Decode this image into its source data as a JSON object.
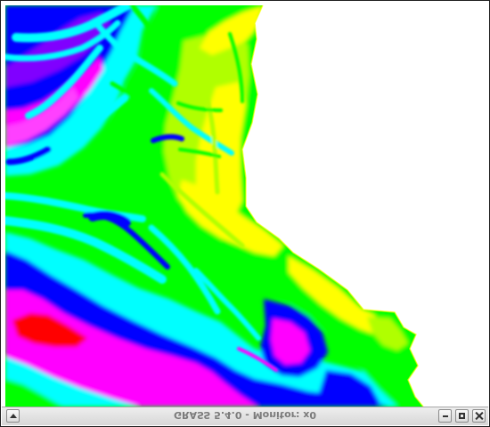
{
  "window": {
    "title": "GRASS 5.4.0 - Monitor: x0"
  },
  "titlebar": {
    "buttons": [
      {
        "name": "window-menu",
        "icon": "triangle-up-icon"
      },
      {
        "name": "minimize",
        "icon": "minimize-icon"
      },
      {
        "name": "maximize",
        "icon": "maximize-icon"
      },
      {
        "name": "close",
        "icon": "close-icon"
      }
    ]
  },
  "map": {
    "content": "rainbow-colored elevation raster",
    "background_color": "#ffffff",
    "palette": [
      "#ff0000",
      "#ff00ff",
      "#0000ff",
      "#00ffff",
      "#00ff00",
      "#ffff00",
      "#ffffff"
    ]
  }
}
